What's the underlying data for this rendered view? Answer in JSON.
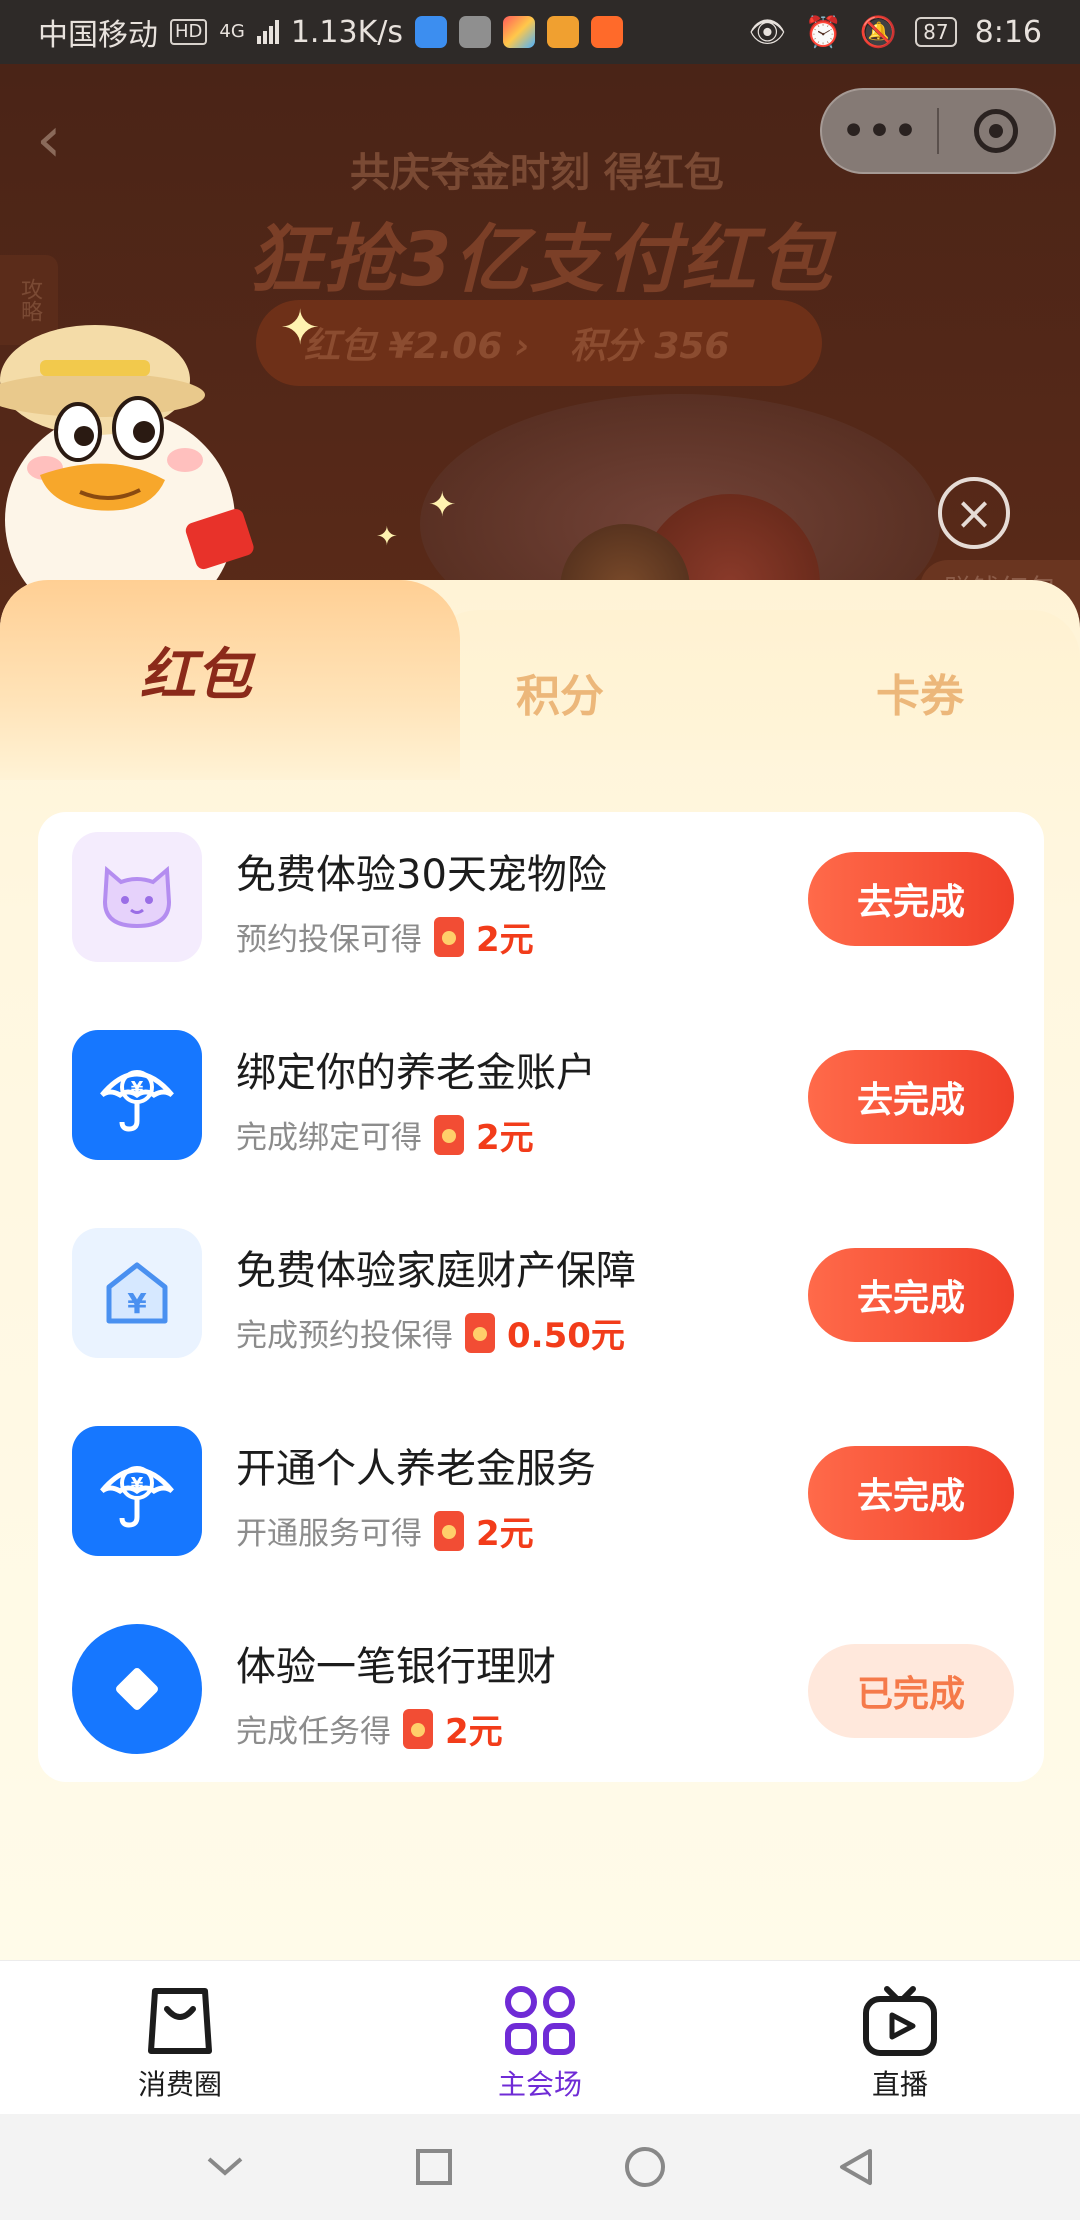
{
  "status_bar": {
    "carrier": "中国移动",
    "hd": "HD",
    "network": "4G",
    "speed": "1.13K/s",
    "battery": "87",
    "time": "8:16"
  },
  "background": {
    "subtitle": "共庆夺金时刻 得红包",
    "title": "狂抢3亿支付红包",
    "redpacket_label": "红包 ¥2.06 ›",
    "points_label": "积分 356",
    "side_label": "攻略",
    "earn_label": "赚钱红包"
  },
  "tabs": [
    {
      "label": "红包",
      "active": true
    },
    {
      "label": "积分",
      "active": false
    },
    {
      "label": "卡券",
      "active": false
    }
  ],
  "tasks": [
    {
      "title": "免费体验30天宠物险",
      "condition": "预约投保可得",
      "reward": "2元",
      "button": "去完成",
      "icon": "cat-shield-icon"
    },
    {
      "title": "绑定你的养老金账户",
      "condition": "完成绑定可得",
      "reward": "2元",
      "button": "去完成",
      "icon": "pension-umbrella-icon"
    },
    {
      "title": "免费体验家庭财产保障",
      "condition": "完成预约投保得",
      "reward": "0.50元",
      "button": "去完成",
      "icon": "house-yuan-icon"
    },
    {
      "title": "开通个人养老金服务",
      "condition": "开通服务可得",
      "reward": "2元",
      "button": "去完成",
      "icon": "pension-umbrella-icon"
    },
    {
      "title": "体验一笔银行理财",
      "condition": "完成任务得",
      "reward": "2元",
      "button": "已完成",
      "icon": "diamond-icon"
    }
  ],
  "bottom_nav": [
    {
      "label": "消费圈",
      "icon": "shopping-bag-icon",
      "active": false
    },
    {
      "label": "主会场",
      "icon": "grid-apps-icon",
      "active": true
    },
    {
      "label": "直播",
      "icon": "tv-play-icon",
      "active": false
    }
  ],
  "colors": {
    "accent_red": "#f23c1a",
    "active_nav": "#6f2bd6",
    "button_gradient_start": "#ff6a4a",
    "button_gradient_end": "#f0402a"
  }
}
